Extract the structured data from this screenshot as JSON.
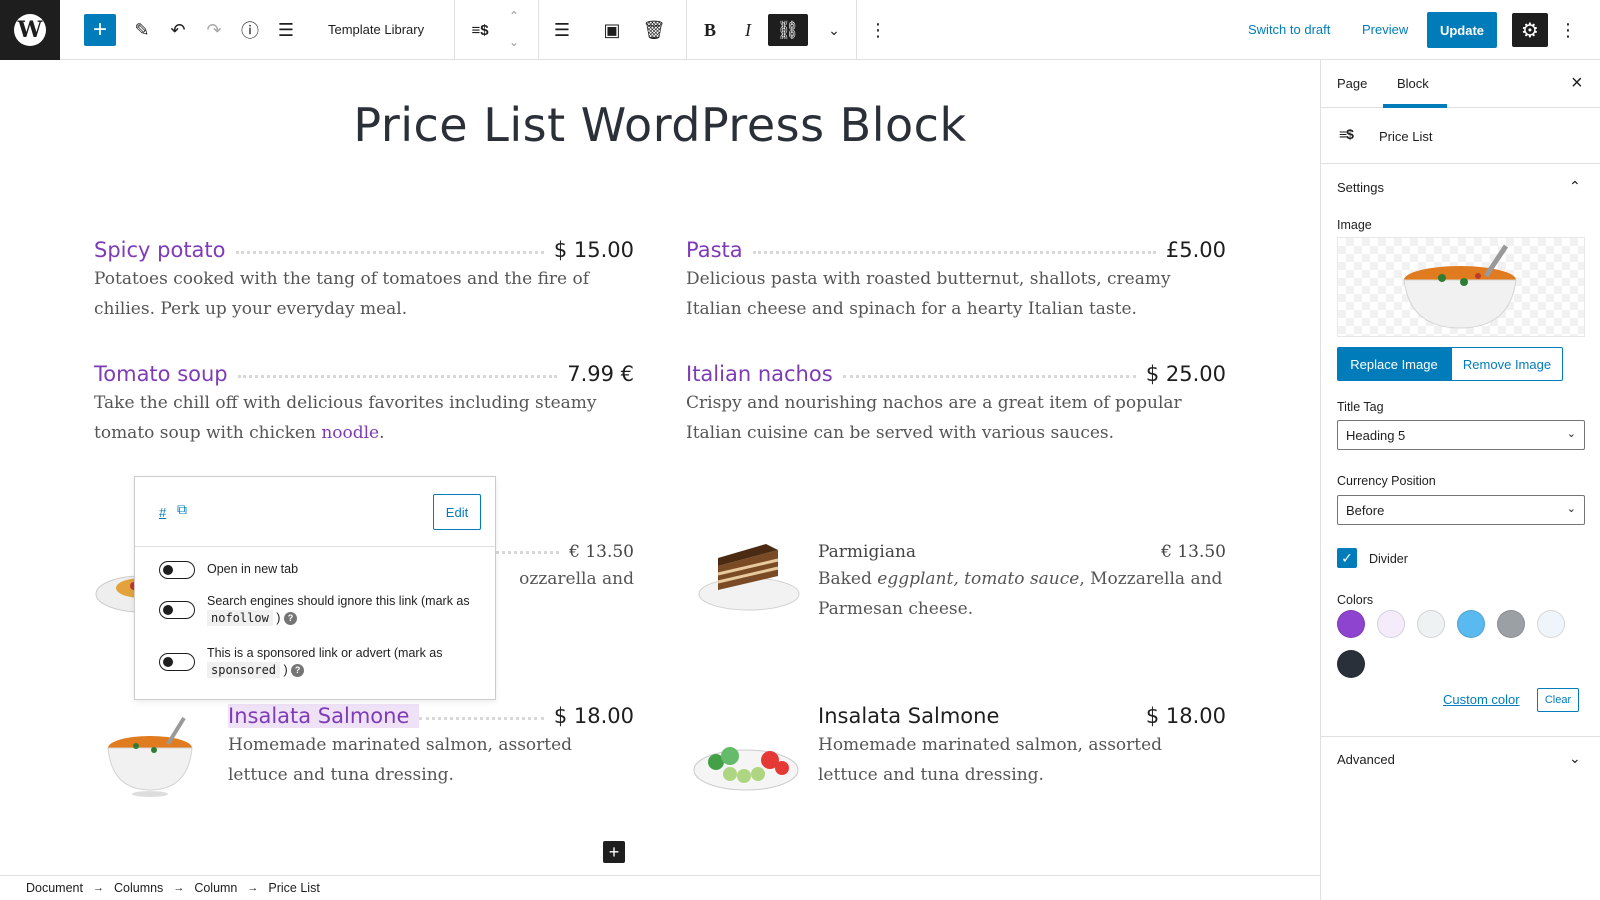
{
  "toolbar": {
    "add": "+",
    "template_library": "Template Library",
    "bold": "B",
    "italic": "I",
    "switch_to_draft": "Switch to draft",
    "preview": "Preview",
    "update": "Update"
  },
  "page": {
    "title": "Price List WordPress Block"
  },
  "items": [
    {
      "name": "Spicy potato",
      "price": "$ 15.00",
      "desc": "Potatoes cooked with the tang of tomatoes and the fire of chilies. Perk up your everyday meal."
    },
    {
      "name": "Pasta",
      "price": "£5.00",
      "desc": "Delicious pasta with roasted butternut, shallots, creamy Italian cheese and spinach for a hearty Italian taste."
    },
    {
      "name": "Tomato soup",
      "price": "7.99  €",
      "desc_pre": "Take the chill off with delicious favorites including steamy tomato soup with chicken ",
      "desc_link": "noodle",
      "desc_post": "."
    },
    {
      "name": "Italian nachos",
      "price": "$ 25.00",
      "desc": "Crispy and nourishing nachos are a great item of popular Italian cuisine can be served with various sauces."
    },
    {
      "price": "€  13.50",
      "desc_visible_1": "ozzarella and"
    },
    {
      "name": "Parmigiana",
      "price": "€  13.50",
      "desc_pre": "Baked ",
      "desc_em": "eggplant, tomato sauce",
      "desc_post": ", Mozzarella and Parmesan cheese."
    },
    {
      "name": "Insalata Salmone",
      "price": "$ 18.00",
      "desc": "Homemade marinated salmon, assorted lettuce and tuna dressing."
    },
    {
      "name": "Insalata Salmone",
      "price": "$ 18.00",
      "desc": "Homemade marinated salmon, assorted lettuce and tuna dressing."
    }
  ],
  "popover": {
    "url": "#",
    "edit": "Edit",
    "open_new_tab": "Open in new tab",
    "nofollow_pre": "Search engines should ignore this link (mark as",
    "nofollow_code": "nofollow",
    "nofollow_post": ")",
    "sponsored_pre": "This is a sponsored link or advert (mark as",
    "sponsored_code": "sponsored",
    "sponsored_post": ")"
  },
  "breadcrumb": [
    "Document",
    "Columns",
    "Column",
    "Price List"
  ],
  "sidebar": {
    "tab_page": "Page",
    "tab_block": "Block",
    "block_name": "Price List",
    "settings": "Settings",
    "image_label": "Image",
    "replace_image": "Replace Image",
    "remove_image": "Remove Image",
    "title_tag_label": "Title Tag",
    "title_tag_value": "Heading 5",
    "currency_position_label": "Currency Position",
    "currency_position_value": "Before",
    "divider_label": "Divider",
    "colors_label": "Colors",
    "colors": [
      "#8e44cf",
      "#f4ecfa",
      "#eef2f2",
      "#5ab9ee",
      "#9aa0a4",
      "#eff5fa",
      "#2a303a"
    ],
    "custom_color": "Custom color",
    "clear": "Clear",
    "advanced": "Advanced"
  }
}
